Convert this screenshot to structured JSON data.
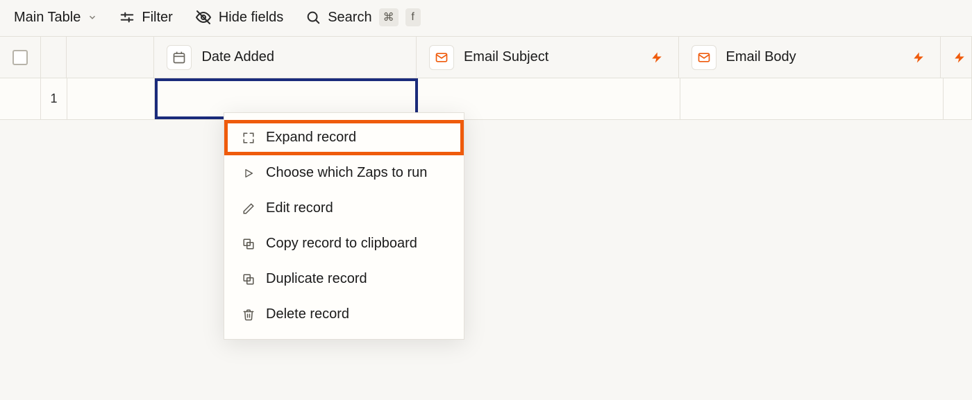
{
  "toolbar": {
    "view_label": "Main Table",
    "filter_label": "Filter",
    "hide_label": "Hide fields",
    "search_label": "Search",
    "search_kbd1": "⌘",
    "search_kbd2": "f"
  },
  "columns": {
    "date_added": "Date Added",
    "email_subject": "Email Subject",
    "email_body": "Email Body"
  },
  "rows": {
    "first_number": "1"
  },
  "menu": {
    "expand": "Expand record",
    "choose_zaps": "Choose which Zaps to run",
    "edit": "Edit record",
    "copy": "Copy record to clipboard",
    "duplicate": "Duplicate record",
    "delete": "Delete record"
  }
}
